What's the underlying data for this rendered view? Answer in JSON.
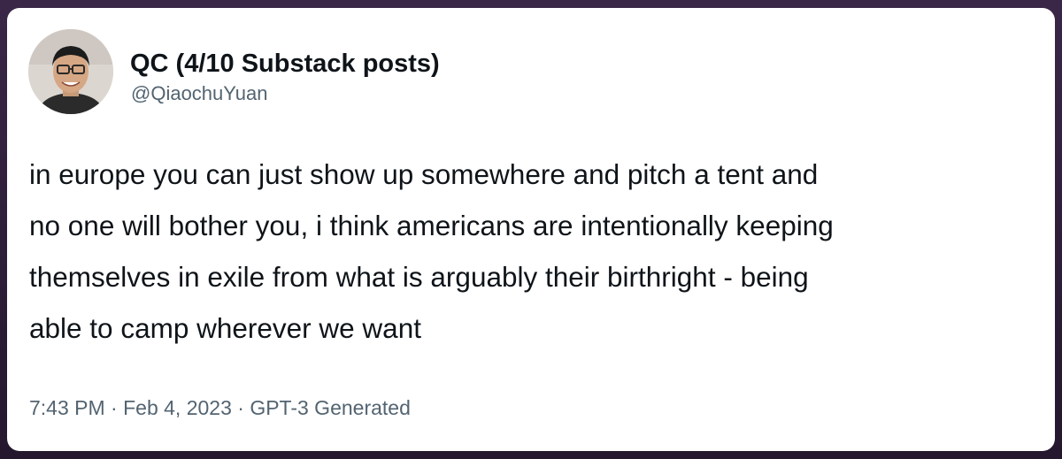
{
  "tweet": {
    "author": {
      "display_name": "QC (4/10 Substack posts)",
      "handle": "@QiaochuYuan"
    },
    "text_lines": [
      "in europe you can just show up somewhere and pitch a tent and",
      "no one will bother you, i think americans are intentionally keeping",
      "themselves in exile from what is arguably their birthright - being",
      "able to camp wherever we want"
    ],
    "time": "7:43 PM",
    "date": "Feb 4, 2023",
    "source": "GPT-3 Generated",
    "separator": "·"
  },
  "colors": {
    "card_background": "#ffffff",
    "frame_background": "#2a1b34",
    "primary_text": "#0f1419",
    "secondary_text": "#536471"
  }
}
